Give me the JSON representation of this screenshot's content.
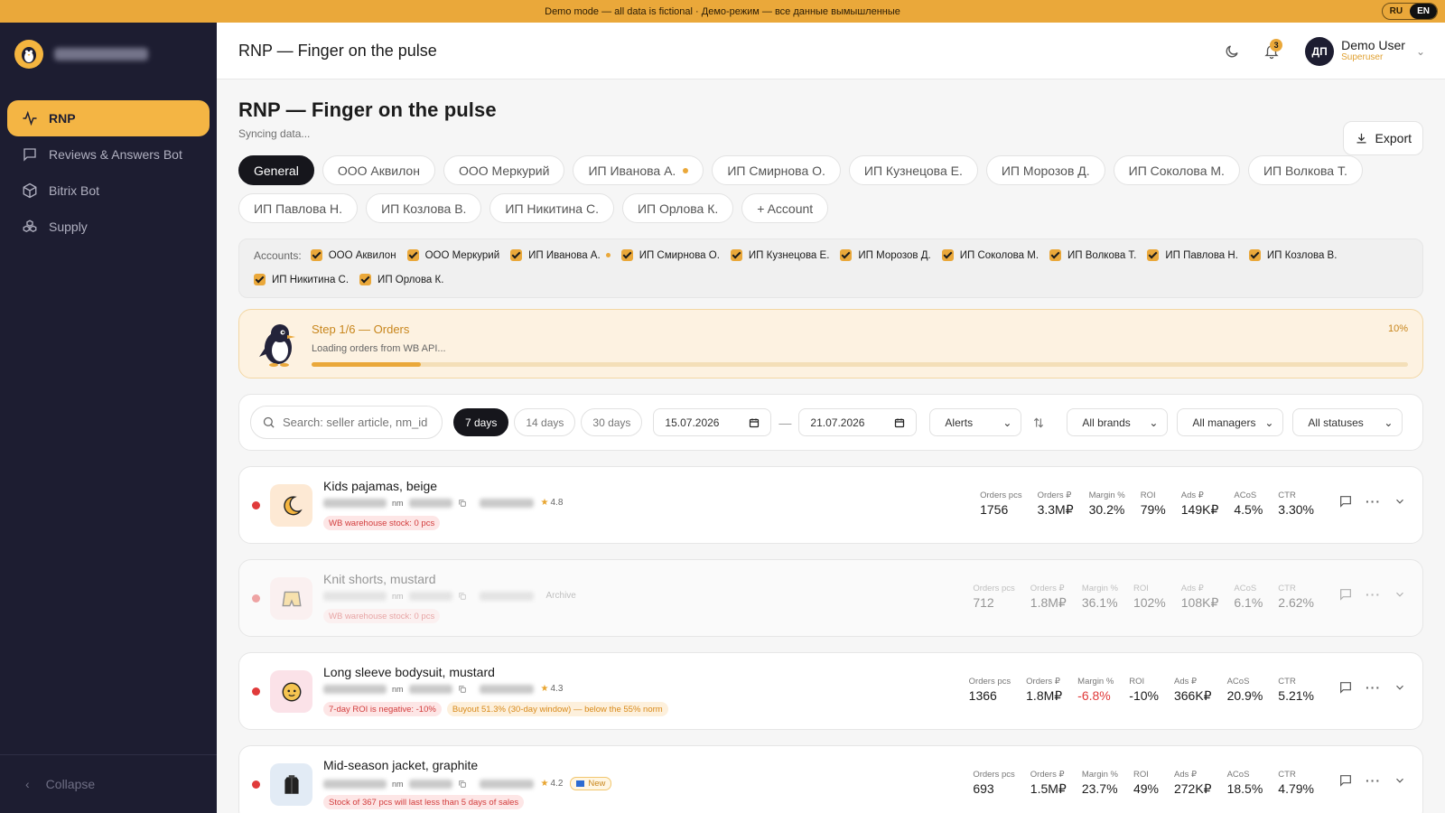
{
  "banner": {
    "text": "Demo mode — all data is fictional · Демо-режим — все данные вымышленные",
    "lang_ru": "RU",
    "lang_en": "EN"
  },
  "sidebar": {
    "items": [
      {
        "label": "RNP",
        "icon": "pulse-icon",
        "active": true
      },
      {
        "label": "Reviews & Answers Bot",
        "icon": "chat-icon"
      },
      {
        "label": "Bitrix Bot",
        "icon": "cube-icon"
      },
      {
        "label": "Supply",
        "icon": "boxes-icon"
      }
    ],
    "collapse_label": "Collapse"
  },
  "topbar": {
    "title": "RNP — Finger on the pulse",
    "notif_count": "3",
    "avatar_initials": "ДП",
    "user_name": "Demo User",
    "user_role": "Superuser"
  },
  "page": {
    "title": "RNP — Finger on the pulse",
    "subtitle": "Syncing data...",
    "export_label": "Export"
  },
  "tabs": [
    "General",
    "ООО Аквилон",
    "ООО Меркурий",
    "ИП Иванова А.",
    "ИП Смирнова О.",
    "ИП Кузнецова Е.",
    "ИП Морозов Д.",
    "ИП Соколова М.",
    "ИП Волкова Т.",
    "ИП Павлова Н.",
    "ИП Козлова В.",
    "ИП Никитина С.",
    "ИП Орлова К.",
    "+ Account"
  ],
  "accounts": {
    "label": "Accounts:",
    "items": [
      "ООО Аквилон",
      "ООО Меркурий",
      "ИП Иванова А.",
      "ИП Смирнова О.",
      "ИП Кузнецова Е.",
      "ИП Морозов Д.",
      "ИП Соколова М.",
      "ИП Волкова Т.",
      "ИП Павлова Н.",
      "ИП Козлова В.",
      "ИП Никитина С.",
      "ИП Орлова К."
    ]
  },
  "progress": {
    "step": "Step 1/6 — Orders",
    "message": "Loading orders from WB API...",
    "percent_label": "10%",
    "fraction": 0.1
  },
  "filters": {
    "search_placeholder": "Search: seller article, nm_id",
    "periods": [
      "7 days",
      "14 days",
      "30 days"
    ],
    "date_from": "15.07.2026",
    "date_to": "21.07.2026",
    "alerts": "Alerts",
    "brands": "All brands",
    "managers": "All managers",
    "statuses": "All statuses"
  },
  "metric_labels": [
    "Orders pcs",
    "Orders ₽",
    "Margin %",
    "ROI",
    "Ads ₽",
    "ACoS",
    "CTR"
  ],
  "products": [
    {
      "name": "Kids pajamas, beige",
      "rating": "4.8",
      "tags": [
        {
          "text": "WB warehouse stock: 0 pcs",
          "type": "red"
        }
      ],
      "values": [
        "1756",
        "3.3M₽",
        "30.2%",
        "79%",
        "149K₽",
        "4.5%",
        "3.30%"
      ]
    },
    {
      "name": "Knit shorts, mustard",
      "archive": "Archive",
      "tags": [
        {
          "text": "WB warehouse stock: 0 pcs",
          "type": "red"
        }
      ],
      "values": [
        "712",
        "1.8M₽",
        "36.1%",
        "102%",
        "108K₽",
        "6.1%",
        "2.62%"
      ]
    },
    {
      "name": "Long sleeve bodysuit, mustard",
      "rating": "4.3",
      "tags": [
        {
          "text": "7-day ROI is negative: -10%",
          "type": "red"
        },
        {
          "text": "Buyout 51.3% (30-day window) — below the 55% norm",
          "type": "org"
        }
      ],
      "values": [
        "1366",
        "1.8M₽",
        "-6.8%",
        "-10%",
        "366K₽",
        "20.9%",
        "5.21%"
      ]
    },
    {
      "name": "Mid-season jacket, graphite",
      "rating": "4.2",
      "new": "New",
      "tags": [
        {
          "text": "Stock of 367 pcs will last less than 5 days of sales",
          "type": "red"
        }
      ],
      "values": [
        "693",
        "1.5M₽",
        "23.7%",
        "49%",
        "272K₽",
        "18.5%",
        "4.79%"
      ]
    }
  ],
  "colors": {
    "accent": "#eaa83a",
    "sidebar": "#1d1d31",
    "alert_red": "#e03a3a"
  }
}
